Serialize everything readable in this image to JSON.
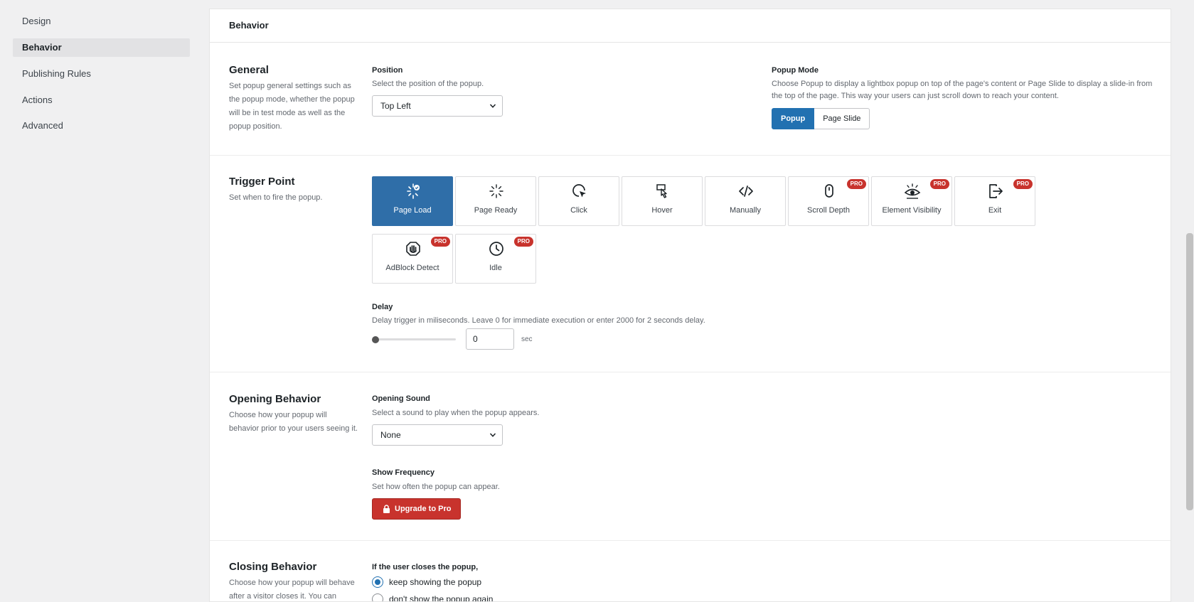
{
  "sidebar": {
    "items": [
      {
        "label": "Design"
      },
      {
        "label": "Behavior"
      },
      {
        "label": "Publishing Rules"
      },
      {
        "label": "Actions"
      },
      {
        "label": "Advanced"
      }
    ]
  },
  "panel": {
    "title": "Behavior"
  },
  "general": {
    "title": "General",
    "desc": "Set popup general settings such as the popup mode, whether the popup will be in test mode as well as the popup position.",
    "position": {
      "label": "Position",
      "desc": "Select the position of the popup.",
      "value": "Top Left"
    },
    "popup_mode": {
      "label": "Popup Mode",
      "desc": "Choose Popup to display a lightbox popup on top of the page's content or Page Slide to display a slide-in from the top of the page. This way your users can just scroll down to reach your content.",
      "options": [
        "Popup",
        "Page Slide"
      ],
      "selected": "Popup"
    }
  },
  "trigger": {
    "title": "Trigger Point",
    "desc": "Set when to fire the popup.",
    "pro_badge": "PRO",
    "options": [
      {
        "label": "Page Load",
        "icon": "page-load-icon",
        "pro": false,
        "active": true
      },
      {
        "label": "Page Ready",
        "icon": "page-ready-icon",
        "pro": false,
        "active": false
      },
      {
        "label": "Click",
        "icon": "click-icon",
        "pro": false,
        "active": false
      },
      {
        "label": "Hover",
        "icon": "hover-icon",
        "pro": false,
        "active": false
      },
      {
        "label": "Manually",
        "icon": "code-icon",
        "pro": false,
        "active": false
      },
      {
        "label": "Scroll Depth",
        "icon": "mouse-icon",
        "pro": true,
        "active": false
      },
      {
        "label": "Element Visibility",
        "icon": "eye-icon",
        "pro": true,
        "active": false
      },
      {
        "label": "Exit",
        "icon": "exit-icon",
        "pro": true,
        "active": false
      },
      {
        "label": "AdBlock Detect",
        "icon": "adblock-icon",
        "pro": true,
        "active": false
      },
      {
        "label": "Idle",
        "icon": "clock-icon",
        "pro": true,
        "active": false
      }
    ],
    "delay": {
      "label": "Delay",
      "desc": "Delay trigger in miliseconds. Leave 0 for immediate execution or enter 2000 for 2 seconds delay.",
      "value": "0",
      "unit": "sec",
      "slider_fraction": 0
    }
  },
  "opening": {
    "title": "Opening Behavior",
    "desc": "Choose how your popup will behavior prior to your users seeing it.",
    "sound": {
      "label": "Opening Sound",
      "desc": "Select a sound to play when the popup appears.",
      "value": "None"
    },
    "frequency": {
      "label": "Show Frequency",
      "desc": "Set how often the popup can appear.",
      "button": "Upgrade to Pro"
    }
  },
  "closing": {
    "title": "Closing Behavior",
    "desc": "Choose how your popup will behave after a visitor closes it. You can",
    "question": "If the user closes the popup,",
    "options": [
      {
        "label": "keep showing the popup",
        "checked": true
      },
      {
        "label": "don't show the popup again",
        "checked": false
      }
    ]
  },
  "colors": {
    "accent": "#2271b1",
    "pro": "#c8332d"
  }
}
